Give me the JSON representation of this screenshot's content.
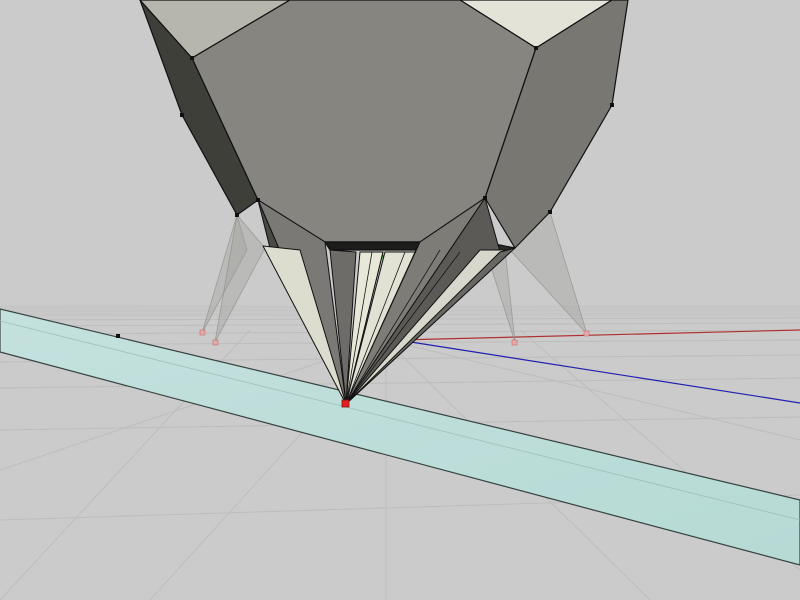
{
  "viewport": {
    "background_color": "#cbcbcb",
    "axis_colors": {
      "x": "#b03030",
      "y": "#2a9a2a",
      "z": "#2020b0"
    },
    "plane_color": "#bfe1dc",
    "mesh_face_color": "#878680",
    "mesh_dark_color": "#3f3f3a",
    "mesh_light_color": "#e4e3d8",
    "vertex_color": "#e02020"
  }
}
